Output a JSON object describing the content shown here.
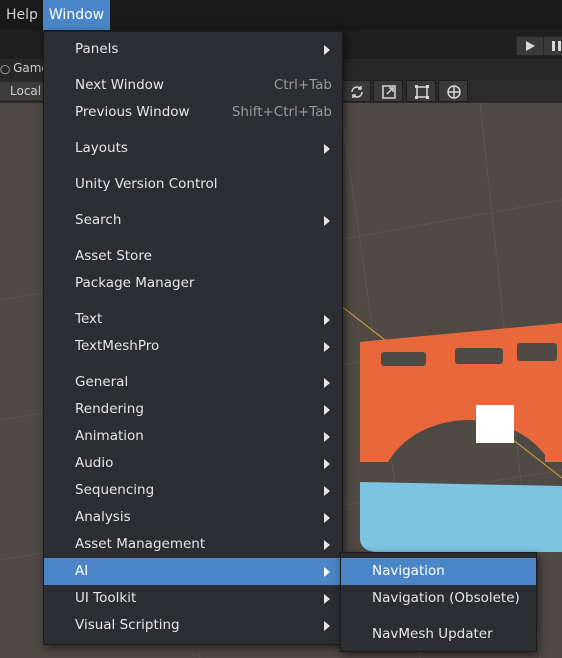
{
  "menubar": {
    "help": "Help",
    "window": "Window"
  },
  "tabs": {
    "game": "Game"
  },
  "scene_toolbar": {
    "pivot": "Local"
  },
  "window_menu": {
    "items": [
      {
        "label": "Panels",
        "arrow": true
      },
      {
        "label": "Next Window",
        "shortcut": "Ctrl+Tab"
      },
      {
        "label": "Previous Window",
        "shortcut": "Shift+Ctrl+Tab"
      },
      {
        "label": "Layouts",
        "arrow": true
      },
      {
        "label": "Unity Version Control"
      },
      {
        "label": "Search",
        "arrow": true
      },
      {
        "label": "Asset Store"
      },
      {
        "label": "Package Manager"
      },
      {
        "label": "Text",
        "arrow": true
      },
      {
        "label": "TextMeshPro",
        "arrow": true
      },
      {
        "label": "General",
        "arrow": true
      },
      {
        "label": "Rendering",
        "arrow": true
      },
      {
        "label": "Animation",
        "arrow": true
      },
      {
        "label": "Audio",
        "arrow": true
      },
      {
        "label": "Sequencing",
        "arrow": true
      },
      {
        "label": "Analysis",
        "arrow": true
      },
      {
        "label": "Asset Management",
        "arrow": true
      },
      {
        "label": "AI",
        "arrow": true,
        "highlighted": true
      },
      {
        "label": "UI Toolkit",
        "arrow": true
      },
      {
        "label": "Visual Scripting",
        "arrow": true
      }
    ]
  },
  "ai_submenu": {
    "items": [
      {
        "label": "Navigation",
        "highlighted": true
      },
      {
        "label": "Navigation (Obsolete)"
      },
      {
        "label": "NavMesh Updater"
      }
    ]
  },
  "colors": {
    "highlight": "#4a86c7",
    "menu_bg": "#2c2e34",
    "bridge": "#e8683c",
    "water": "#7cc4e2"
  }
}
